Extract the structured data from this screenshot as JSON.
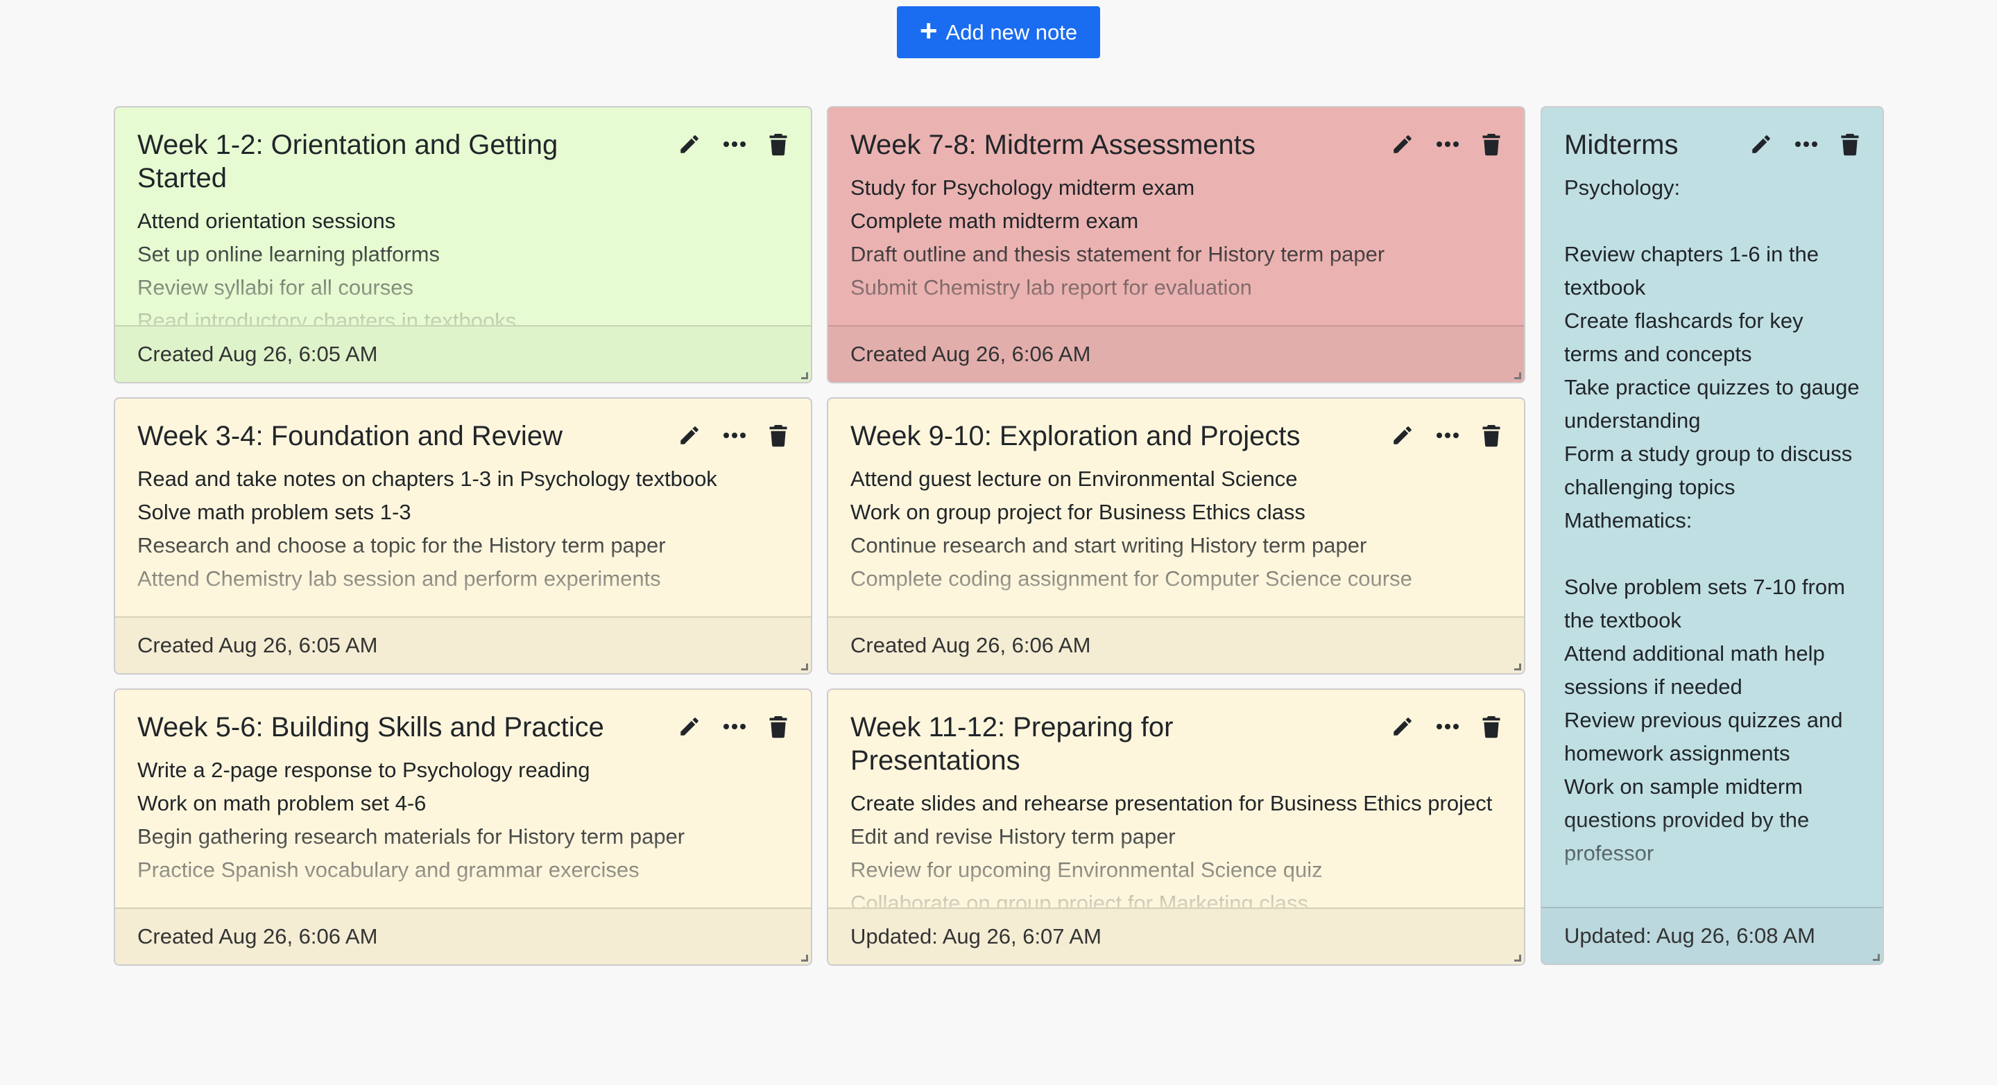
{
  "toolbar": {
    "add_label": "Add new note",
    "add_color": "#1a6cf0"
  },
  "notes": [
    {
      "title": "Week 1-2: Orientation and Getting Started",
      "content": "Attend orientation sessions\nSet up online learning platforms\nReview syllabi for all courses\nRead introductory chapters in textbooks",
      "footer": "Created Aug 26, 6:05 AM",
      "color": "#e6fbd2",
      "footer_color": "#dff3cb"
    },
    {
      "title": "Week 7-8: Midterm Assessments",
      "content": "Study for Psychology midterm exam\nComplete math midterm exam\nDraft outline and thesis statement for History term paper\nSubmit Chemistry lab report for evaluation",
      "footer": "Created Aug 26, 6:06 AM",
      "color": "#eab3b1",
      "footer_color": "#e2aeac"
    },
    {
      "title": "Midterms",
      "content": "Psychology:\n\nReview chapters 1-6 in the textbook\nCreate flashcards for key terms and concepts\nTake practice quizzes to gauge understanding\nForm a study group to discuss challenging topics\nMathematics:\n\nSolve problem sets 7-10 from the textbook\nAttend additional math help sessions if needed\nReview previous quizzes and homework assignments\nWork on sample midterm questions provided by the professor",
      "footer": "Updated: Aug 26, 6:08 AM",
      "color": "#c0dfe3",
      "footer_color": "#bad8dd"
    },
    {
      "title": "Week 3-4: Foundation and Review",
      "content": "Read and take notes on chapters 1-3 in Psychology textbook\nSolve math problem sets 1-3\nResearch and choose a topic for the History term paper\nAttend Chemistry lab session and perform experiments",
      "footer": "Created Aug 26, 6:05 AM",
      "color": "#fdf6dd",
      "footer_color": "#f4edd4"
    },
    {
      "title": "Week 9-10: Exploration and Projects",
      "content": "Attend guest lecture on Environmental Science\nWork on group project for Business Ethics class\nContinue research and start writing History term paper\nComplete coding assignment for Computer Science course",
      "footer": "Created Aug 26, 6:06 AM",
      "color": "#fdf6dd",
      "footer_color": "#f4edd4"
    },
    {
      "title": "Week 5-6: Building Skills and Practice",
      "content": "Write a 2-page response to Psychology reading\nWork on math problem set 4-6\nBegin gathering research materials for History term paper\nPractice Spanish vocabulary and grammar exercises",
      "footer": "Created Aug 26, 6:06 AM",
      "color": "#fdf6dd",
      "footer_color": "#f4edd4"
    },
    {
      "title": "Week 11-12: Preparing for Presentations",
      "content": "Create slides and rehearse presentation for Business Ethics project\nEdit and revise History term paper\nReview for upcoming Environmental Science quiz\nCollaborate on group project for Marketing class",
      "footer": "Updated: Aug 26, 6:07 AM",
      "color": "#fdf6dd",
      "footer_color": "#f4edd4"
    }
  ]
}
